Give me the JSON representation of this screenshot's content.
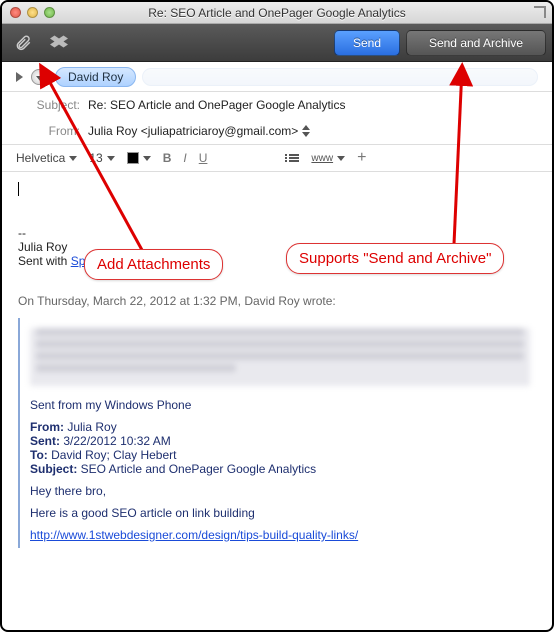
{
  "window": {
    "title": "Re: SEO Article and OnePager Google Analytics"
  },
  "toolbar": {
    "send_label": "Send",
    "send_archive_label": "Send and Archive"
  },
  "recipients": {
    "to_tokens": [
      "David Roy"
    ]
  },
  "fields": {
    "subject_label": "Subject:",
    "subject_value": "Re: SEO Article and OnePager Google Analytics",
    "from_label": "From:",
    "from_value": "Julia Roy <juliapatriciaroy@gmail.com>"
  },
  "format": {
    "font": "Helvetica",
    "size": "13",
    "www": "www"
  },
  "signature": {
    "dashes": "--",
    "name": "Julia Roy",
    "sent_with": "Sent with ",
    "app": "Sparrow"
  },
  "quote": {
    "intro": "On Thursday, March 22, 2012 at 1:32 PM, David Roy wrote:",
    "sent_from": "Sent from my Windows Phone",
    "from_lbl": "From: ",
    "from_val": "Julia Roy",
    "sent_lbl": "Sent: ",
    "sent_val": "3/22/2012 10:32 AM",
    "to_lbl": "To: ",
    "to_val": "David Roy; Clay Hebert",
    "subj_lbl": "Subject: ",
    "subj_val": "SEO Article and OnePager Google Analytics",
    "greeting": "Hey there bro,",
    "line1": "Here is a good SEO article on link building",
    "link": "http://www.1stwebdesigner.com/design/tips-build-quality-links/"
  },
  "annotations": {
    "attach": "Add Attachments",
    "sendarch": "Supports \"Send and Archive\""
  }
}
